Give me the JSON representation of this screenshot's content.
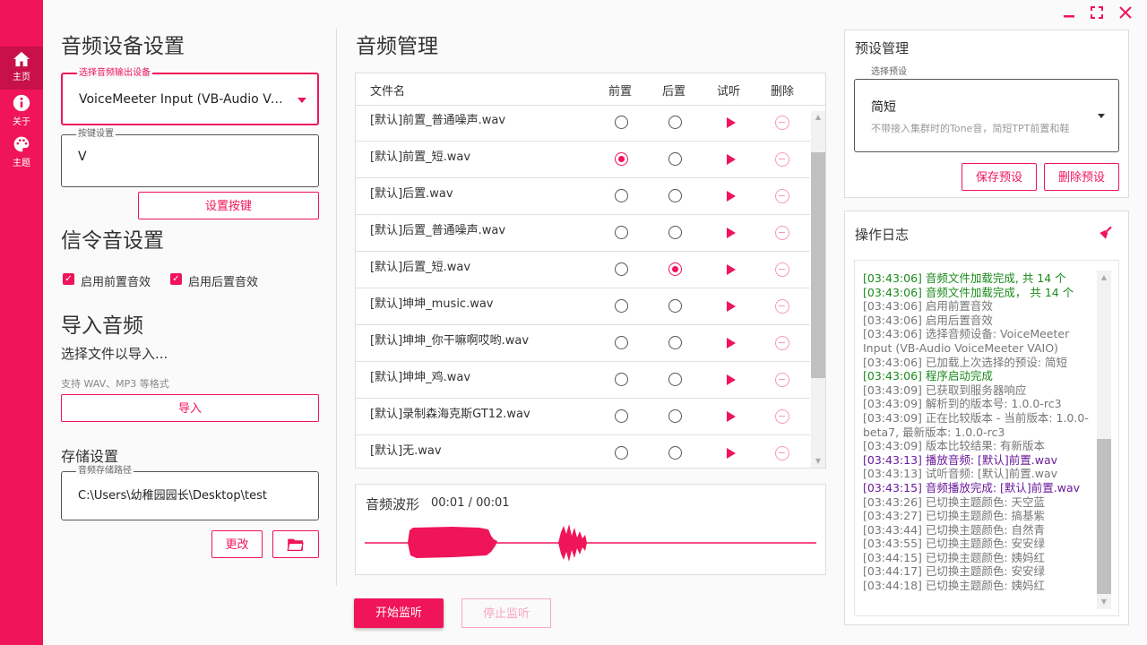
{
  "colors": {
    "accent": "#f0145a",
    "log_green": "#1a8a1a",
    "log_purple": "#6a1a9a",
    "log_gray": "#777777"
  },
  "nav": {
    "home": {
      "label": "主页",
      "icon": "home-icon"
    },
    "about": {
      "label": "关于",
      "icon": "info-icon"
    },
    "theme": {
      "label": "主题",
      "icon": "palette-icon"
    }
  },
  "window": {
    "minimize": "minimize-icon",
    "maximize": "maximize-icon",
    "close": "close-icon"
  },
  "device": {
    "title": "音频设备设置",
    "output_label": "选择音频输出设备",
    "output_value": "VoiceMeeter Input (VB-Audio Voice...",
    "hotkey_label": "按键设置",
    "hotkey_value": "V",
    "set_hotkey_button": "设置按键"
  },
  "signal": {
    "title": "信令音设置",
    "enable_pre": "启用前置音效",
    "enable_post": "启用后置音效"
  },
  "import": {
    "title": "导入音频",
    "subtitle": "选择文件以导入...",
    "hint": "支持 WAV、MP3 等格式",
    "button": "导入"
  },
  "storage": {
    "title": "存储设置",
    "path_label": "音频存储路径",
    "path_value": "C:\\Users\\幼稚园园长\\Desktop\\test",
    "change_button": "更改",
    "folder_icon": "folder-icon"
  },
  "audio": {
    "title": "音频管理",
    "columns": {
      "name": "文件名",
      "pre": "前置",
      "post": "后置",
      "preview": "试听",
      "delete": "删除"
    },
    "rows": [
      {
        "name": "[默认]前置_普通噪声.wav",
        "pre": false,
        "post": false
      },
      {
        "name": "[默认]前置_短.wav",
        "pre": true,
        "post": false
      },
      {
        "name": "[默认]后置.wav",
        "pre": false,
        "post": false
      },
      {
        "name": "[默认]后置_普通噪声.wav",
        "pre": false,
        "post": false
      },
      {
        "name": "[默认]后置_短.wav",
        "pre": false,
        "post": true
      },
      {
        "name": "[默认]坤坤_music.wav",
        "pre": false,
        "post": false
      },
      {
        "name": "[默认]坤坤_你干嘛啊哎哟.wav",
        "pre": false,
        "post": false
      },
      {
        "name": "[默认]坤坤_鸡.wav",
        "pre": false,
        "post": false
      },
      {
        "name": "[默认]录制森海克斯GT12.wav",
        "pre": false,
        "post": false
      },
      {
        "name": "[默认]无.wav",
        "pre": false,
        "post": false
      }
    ]
  },
  "waveform": {
    "title": "音频波形",
    "time": "00:01 / 00:01"
  },
  "monitor": {
    "start": "开始监听",
    "stop": "停止监听"
  },
  "preset": {
    "title": "预设管理",
    "select_label": "选择预设",
    "value": "简短",
    "description": "不带接入集群时的Tone音，简短TPT前置和鞋",
    "save": "保存预设",
    "delete": "删除预设"
  },
  "log": {
    "title": "操作日志",
    "clear_icon": "broom-icon",
    "lines": [
      {
        "text": "[03:43:06] 音频文件加载完成, 共 14 个",
        "kind": "green"
      },
      {
        "text": "[03:43:06] 音频文件加载完成， 共 14 个",
        "kind": "green"
      },
      {
        "text": "[03:43:06] 启用前置音效",
        "kind": "gray"
      },
      {
        "text": "[03:43:06] 启用后置音效",
        "kind": "gray"
      },
      {
        "text": "[03:43:06] 选择音频设备: VoiceMeeter Input (VB-Audio VoiceMeeter VAIO)",
        "kind": "gray"
      },
      {
        "text": "[03:43:06] 已加载上次选择的预设: 简短",
        "kind": "gray"
      },
      {
        "text": "[03:43:06] 程序启动完成",
        "kind": "green"
      },
      {
        "text": "[03:43:09] 已获取到服务器响应",
        "kind": "gray"
      },
      {
        "text": "[03:43:09] 解析到的版本号: 1.0.0-rc3",
        "kind": "gray"
      },
      {
        "text": "[03:43:09] 正在比较版本 - 当前版本: 1.0.0-beta7, 最新版本: 1.0.0-rc3",
        "kind": "gray"
      },
      {
        "text": "[03:43:09] 版本比较结果: 有新版本",
        "kind": "gray"
      },
      {
        "text": "[03:43:13] 播放音频: [默认]前置.wav",
        "kind": "purple"
      },
      {
        "text": "[03:43:13] 试听音频: [默认]前置.wav",
        "kind": "gray"
      },
      {
        "text": "[03:43:15] 音频播放完成: [默认]前置.wav",
        "kind": "purple"
      },
      {
        "text": "[03:43:26] 已切换主题颜色: 天空蓝",
        "kind": "gray"
      },
      {
        "text": "[03:43:27] 已切换主题颜色: 搞基紫",
        "kind": "gray"
      },
      {
        "text": "[03:43:44] 已切换主题颜色: 自然青",
        "kind": "gray"
      },
      {
        "text": "[03:43:55] 已切换主题颜色: 安安绿",
        "kind": "gray"
      },
      {
        "text": "[03:44:15] 已切换主题颜色: 姨妈红",
        "kind": "gray"
      },
      {
        "text": "[03:44:17] 已切换主题颜色: 安安绿",
        "kind": "gray"
      },
      {
        "text": "[03:44:18] 已切换主题颜色: 姨妈红",
        "kind": "gray"
      }
    ]
  }
}
